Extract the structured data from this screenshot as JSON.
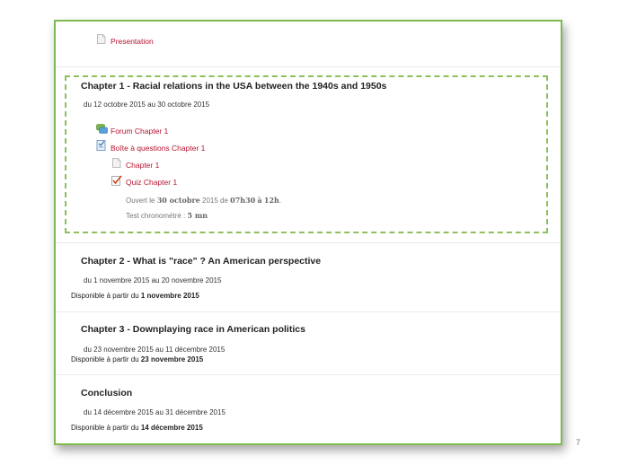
{
  "top_activity": {
    "label": "Presentation",
    "icon": "document-icon"
  },
  "chapter1": {
    "title": "Chapter 1 - Racial relations in the USA between the 1940s and 1950s",
    "dates": "du 12 octobre 2015 au 30 octobre 2015",
    "activities": [
      {
        "label": "Forum Chapter 1",
        "icon": "forum-icon"
      },
      {
        "label": "Boîte à questions Chapter 1",
        "icon": "questionnaire-icon"
      },
      {
        "label": "Chapter 1",
        "icon": "document-icon"
      },
      {
        "label": "Quiz Chapter 1",
        "icon": "quiz-icon"
      }
    ],
    "quiz_info": {
      "open_prefix": "Ouvert le",
      "open_date": "30 octobre",
      "open_year_from": "2015 de",
      "open_start": "07h30",
      "open_to": "à",
      "open_end": "12h",
      "open_suffix": ".",
      "timer_label": "Test chronométré :",
      "timer_value": "5 mn"
    }
  },
  "chapter2": {
    "title": "Chapter 2 - What is \"race\" ? An American perspective",
    "dates": "du 1 novembre 2015 au 20 novembre 2015",
    "avail_prefix": "Disponible à partir du",
    "avail_date": "1 novembre 2015"
  },
  "chapter3": {
    "title": "Chapter 3 - Downplaying race in American politics",
    "dates": "du 23 novembre 2015 au 11 décembre 2015",
    "avail_prefix": "Disponible à partir du",
    "avail_date": "23 novembre 2015"
  },
  "conclusion": {
    "title": "Conclusion",
    "dates": "du 14 décembre 2015 au 31 décembre 2015",
    "avail_prefix": "Disponible à partir du",
    "avail_date": "14 décembre 2015"
  },
  "page_number": "7",
  "colors": {
    "link": "#b5132f",
    "border": "#7dbb4f",
    "dashed": "#8fbf5c"
  }
}
